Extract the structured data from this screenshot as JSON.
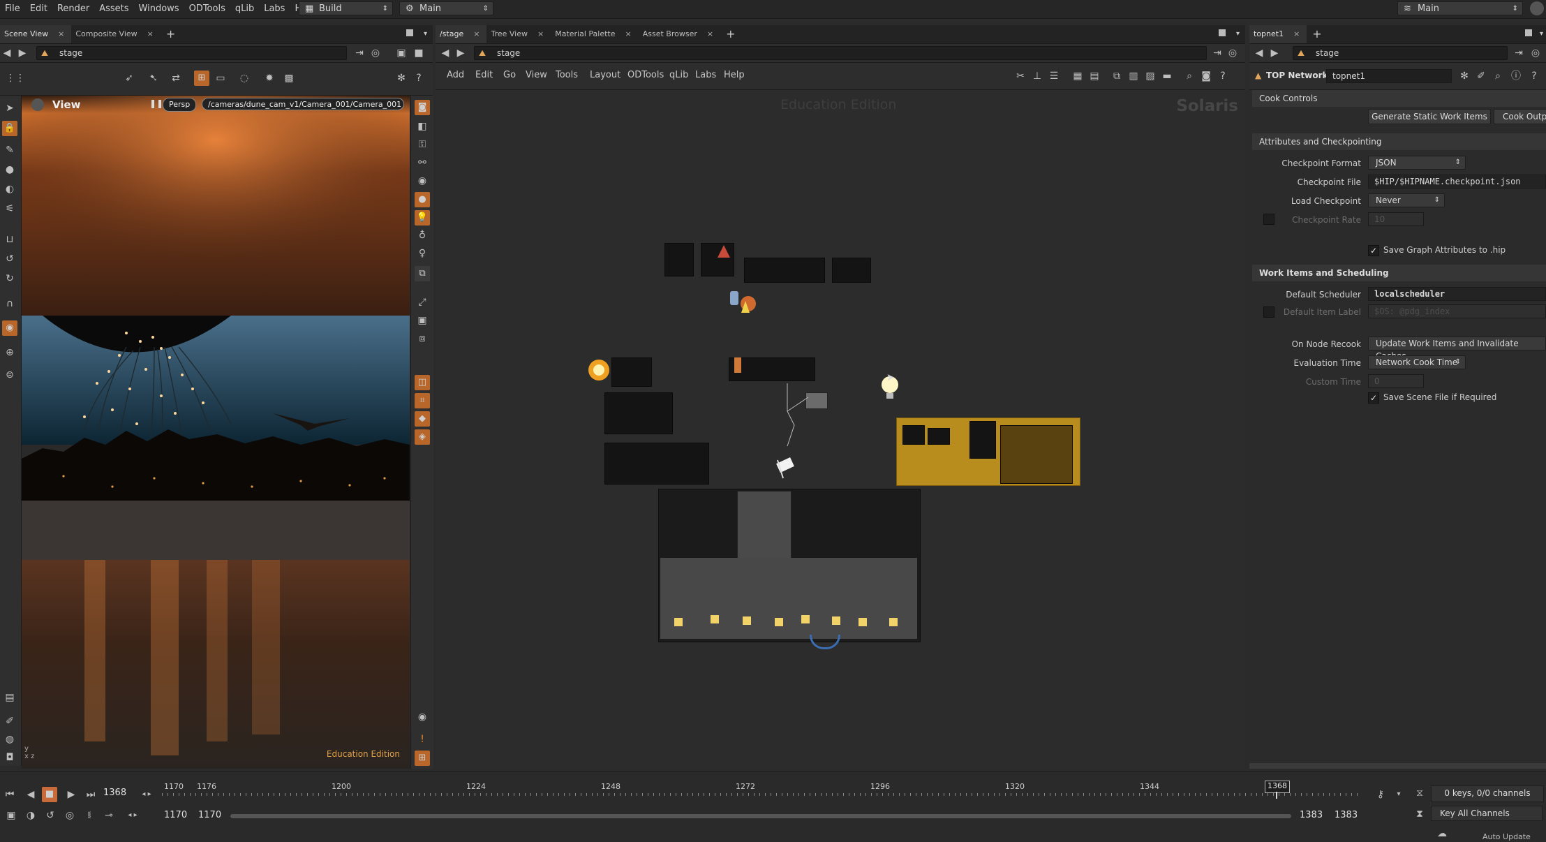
{
  "menubar": {
    "items": [
      "File",
      "Edit",
      "Render",
      "Assets",
      "Windows",
      "ODTools",
      "qLib",
      "Labs",
      "Help"
    ],
    "desktop": "Build",
    "context": "Main",
    "right_context": "Main"
  },
  "left_pane": {
    "tabs": [
      "Scene View",
      "Composite View"
    ],
    "path": "stage",
    "view_label": "View",
    "camera_menu": "Persp",
    "camera_path": "/cameras/dune_cam_v1/Camera_001/Camera_001",
    "watermark": "Education Edition",
    "axis_label": "y\nx z"
  },
  "center_pane": {
    "tabs": [
      "/stage",
      "Tree View",
      "Material Palette",
      "Asset Browser"
    ],
    "path": "stage",
    "menus": [
      "Add",
      "Edit",
      "Go",
      "View",
      "Tools",
      "Layout",
      "ODTools",
      "qLib",
      "Labs",
      "Help"
    ],
    "watermark_top": "Education Edition",
    "watermark_right": "Solaris"
  },
  "right_pane": {
    "tab": "topnet1",
    "path": "stage",
    "node_type": "TOP Network",
    "node_name": "topnet1",
    "cook_controls": "Cook Controls",
    "generate_btn": "Generate Static Work Items",
    "cook_output_btn": "Cook Outp",
    "sec_attributes": "Attributes and Checkpointing",
    "checkpoint_format_label": "Checkpoint Format",
    "checkpoint_format_value": "JSON",
    "checkpoint_file_label": "Checkpoint File",
    "checkpoint_file_value": "$HIP/$HIPNAME.checkpoint.json",
    "load_checkpoint_label": "Load Checkpoint",
    "load_checkpoint_value": "Never",
    "checkpoint_rate_label": "Checkpoint Rate",
    "checkpoint_rate_value": "10",
    "save_graph_label": "Save Graph Attributes to .hip",
    "sec_work_items": "Work Items and Scheduling",
    "default_scheduler_label": "Default Scheduler",
    "default_scheduler_value": "localscheduler",
    "default_item_label_label": "Default Item Label",
    "default_item_label_value": "$OS: @pdg_index",
    "on_node_recook_label": "On Node Recook",
    "on_node_recook_value": "Update Work Items and Invalidate Caches",
    "evaluation_time_label": "Evaluation Time",
    "evaluation_time_value": "Network Cook Time",
    "custom_time_label": "Custom Time",
    "custom_time_value": "0",
    "save_scene_label": "Save Scene File if Required"
  },
  "timeline": {
    "current_frame": "1368",
    "ticks": [
      "1170",
      "1176",
      "1200",
      "1224",
      "1248",
      "1272",
      "1296",
      "1320",
      "1344"
    ],
    "marker": "1368",
    "start_a": "1170",
    "start_b": "1170",
    "end_a": "1383",
    "end_b": "1383",
    "keys_label": "0 keys, 0/0 channels",
    "key_all_label": "Key All Channels",
    "auto_update": "Auto Update"
  },
  "colors": {
    "accent_yellow": "#b98c1e",
    "bg": "#2b2b2b"
  }
}
